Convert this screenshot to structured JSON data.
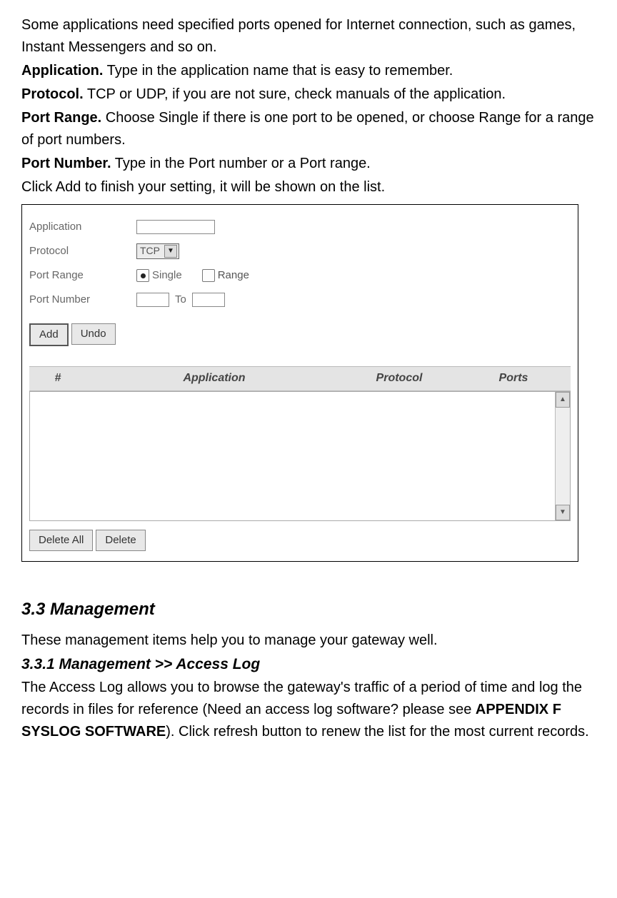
{
  "intro": {
    "p1": "Some applications need specified ports opened for Internet connection, such as games, Instant Messengers and so on.",
    "app_b": "Application.",
    "app_t": " Type in the application name that is easy to remember.",
    "proto_b": "Protocol.",
    "proto_t": " TCP or UDP, if you are not sure, check manuals of the application.",
    "range_b": "Port Range.",
    "range_t": " Choose Single if there is one port to be opened, or choose Range for a range of port numbers.",
    "num_b": "Port Number.",
    "num_t": " Type in the Port number or a Port range.",
    "p2": "Click Add to finish your setting, it will be shown on the list."
  },
  "form": {
    "application_label": "Application",
    "protocol_label": "Protocol",
    "protocol_value": "TCP",
    "portrange_label": "Port Range",
    "single": "Single",
    "range": "Range",
    "portnumber_label": "Port Number",
    "to": "To",
    "add": "Add",
    "undo": "Undo",
    "col_num": "#",
    "col_app": "Application",
    "col_proto": "Protocol",
    "col_ports": "Ports",
    "delete_all": "Delete All",
    "delete": "Delete"
  },
  "section": {
    "head": "3.3 Management",
    "p1": "These management items help you to manage your gateway well.",
    "sub": "3.3.1 Management >> Access Log",
    "p2a": "The Access Log allows you to browse the gateway's traffic of a period of time and log the records in files for reference (Need an access log software? please see ",
    "p2b": "APPENDIX F SYSLOG SOFTWARE",
    "p2c": "). Click refresh button to renew the list for the most current records."
  }
}
